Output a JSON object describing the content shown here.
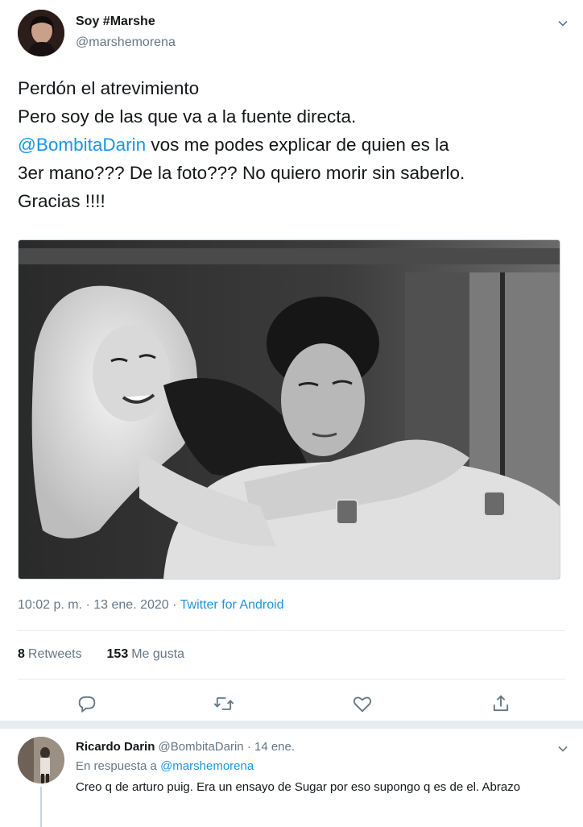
{
  "tweet": {
    "author_name": "Soy #Marshe",
    "author_handle": "@marshemorena",
    "text_lines": {
      "l1": "Perdón el atrevimiento",
      "l2": "Pero soy de las que va a la fuente directa.",
      "l3_mention": "@BombitaDarin",
      "l3_rest": " vos me podes explicar de quien es la",
      "l4": "3er mano??? De la foto??? No quiero morir sin saberlo.",
      "l5": "Gracias !!!!"
    },
    "timestamp": "10:02 p. m. · 13 ene. 2020 · ",
    "source": "Twitter for Android",
    "retweets_count": "8",
    "retweets_label": "Retweets",
    "likes_count": "153",
    "likes_label": "Me gusta",
    "icons": {
      "caret": "chevron-down-icon",
      "reply": "reply-icon",
      "retweet": "retweet-icon",
      "like": "heart-icon",
      "share": "share-icon"
    }
  },
  "reply": {
    "author_name": "Ricardo Darin",
    "author_handle": "@BombitaDarin",
    "date": "· 14 ene.",
    "in_reply_prefix": "En respuesta a ",
    "in_reply_mention": "@marshemorena",
    "text": "Creo q de arturo puig. Era un ensayo de Sugar por eso supongo q es de el. Abrazo"
  },
  "colors": {
    "link": "#1b95e0",
    "secondary_text": "#657786",
    "divider": "#e6ecf0"
  }
}
